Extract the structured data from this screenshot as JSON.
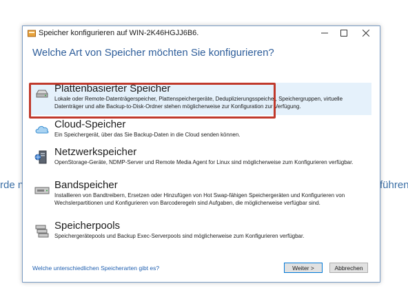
{
  "background": {
    "left_fragment": "rde n",
    "right_fragment": "führen"
  },
  "dialog": {
    "title": "Speicher konfigurieren auf WIN-2K46HGJJ6B6.",
    "heading": "Welche Art von Speicher möchten Sie konfigurieren?",
    "options": [
      {
        "title": "Plattenbasierter Speicher",
        "description": "Lokale oder Remote-Datenträgerspeicher, Plattenspeichergeräte, Deduplizierungsspeicher, Speichergruppen, virtuelle Datenträger und alte Backup-to-Disk-Ordner stehen möglicherweise zur Konfiguration zur Verfügung.",
        "icon": "disk-icon"
      },
      {
        "title": "Cloud-Speicher",
        "description": "Ein Speichergerät, über das Sie Backup-Daten in die Cloud senden können.",
        "icon": "cloud-icon"
      },
      {
        "title": "Netzwerkspeicher",
        "description": "OpenStorage-Geräte, NDMP-Server und Remote Media Agent for Linux sind möglicherweise zum Konfigurieren verfügbar.",
        "icon": "network-storage-icon"
      },
      {
        "title": "Bandspeicher",
        "description": "Installieren von Bandtreibern, Ersetzen oder Hinzufügen von Hot Swap-fähigen Speichergeräten und Konfigurieren von Wechslerpartitionen und Konfigurieren von Barcoderegeln sind Aufgaben, die möglicherweise verfügbar sind.",
        "icon": "tape-icon"
      },
      {
        "title": "Speicherpools",
        "description": "Speichergerätepools und Backup Exec-Serverpools sind möglicherweise zum Konfigurieren verfügbar.",
        "icon": "storage-pool-icon"
      }
    ],
    "help_link": "Welche unterschiedlichen Speicherarten gibt es?",
    "next_label": "Weiter >",
    "cancel_label": "Abbrechen"
  },
  "colors": {
    "highlight": "#c0392b",
    "heading": "#2d5d9a",
    "selection": "#e5f1fb"
  }
}
